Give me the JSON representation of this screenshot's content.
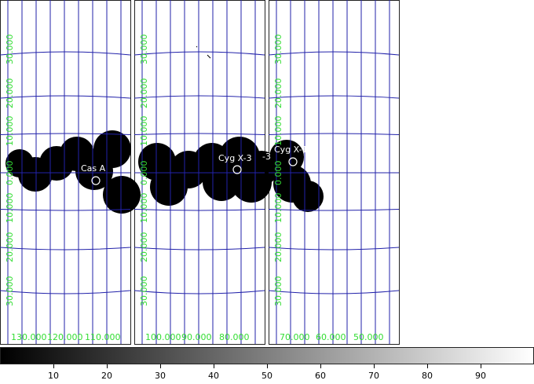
{
  "panels": [
    {
      "lat_labels": [
        "30.000",
        "20.000",
        "10.000",
        "0.000",
        "10.000",
        "20.000",
        "30.000"
      ],
      "lon_labels": [
        "130.000",
        "120.000",
        "110.000"
      ],
      "sources": [
        {
          "name": "Cas A"
        }
      ]
    },
    {
      "lat_labels": [
        "30.000",
        "20.000",
        "10.000",
        "0.000",
        "10.000",
        "20.000",
        "30.000"
      ],
      "lon_labels": [
        "100.000",
        "90.000",
        "80.000"
      ],
      "sources": [
        {
          "name": "Cyg X-3"
        },
        {
          "name": "-3"
        }
      ]
    },
    {
      "lat_labels": [
        "30.000",
        "20.000",
        "10.000",
        "0.000",
        "10.000",
        "20.000",
        "30.000"
      ],
      "lon_labels": [
        "70.000",
        "60.000",
        "50.000"
      ],
      "sources": [
        {
          "name": "Cyg X-1"
        }
      ]
    }
  ],
  "colorbar": {
    "ticks": [
      "10",
      "20",
      "30",
      "40",
      "50",
      "60",
      "70",
      "80",
      "90"
    ],
    "colors": {
      "low": "#000000",
      "high": "#ffffff"
    }
  },
  "colors": {
    "grid": "#2222aa",
    "labels": "#33dd33",
    "blobs": "#000000",
    "source_marker": "#ffffff"
  }
}
